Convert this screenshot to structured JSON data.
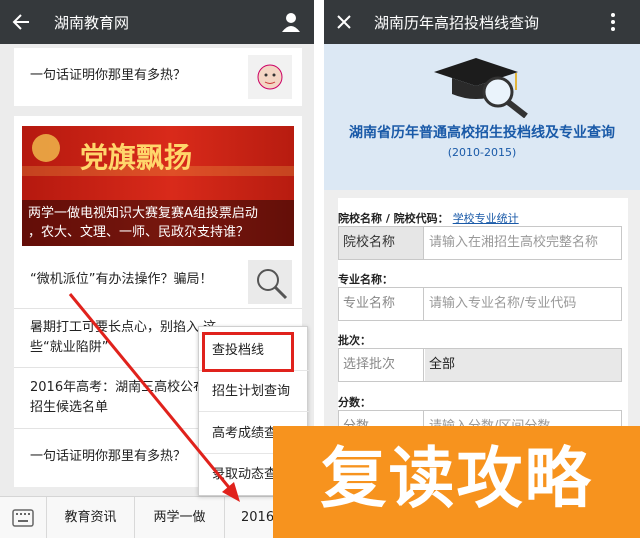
{
  "colors": {
    "topbar": "#35393c",
    "accent_red": "#e0221c",
    "link": "#1a5aa8",
    "overlay": "#f7931e"
  },
  "left": {
    "title": "湖南教育网",
    "feed": [
      {
        "text": "一句话证明你那里有多热？",
        "thumb": "cartoon-thumb"
      },
      {
        "banner_text_line1": "党旗飘扬",
        "caption_line1": "两学一做电视知识大赛复赛A组投票启动",
        "caption_line2": "，农大、文理、一师、民政尕支持谁？"
      },
      {
        "text": "“微机派位”有办法操作？骗局！",
        "thumb": "magnifier-thumb"
      },
      {
        "text_line1": "暑期打工可要长点心，别掐入 这",
        "text_line2": "些“就业陷阱”"
      },
      {
        "text_line1": "2016年高考：湖南三高校公布",
        "text_line2": "招生候选名单"
      },
      {
        "text": "一句话证明你那里有多热？"
      }
    ],
    "popup": [
      "查投档线",
      "招生计划查询",
      "高考成绩查",
      "录取动态查"
    ],
    "bottom_nav": {
      "item1": "教育资讯",
      "item2": "两学一做",
      "item3": "2016高考"
    }
  },
  "right": {
    "title": "湖南历年高招投档线查询",
    "hero_title": "湖南省历年普通高校招生投档线及专业查询",
    "hero_years": "(2010-2015)",
    "school_label": "院校名称 / 院校代码：",
    "school_link": "学校专业统计",
    "school_field_label": "院校名称",
    "school_placeholder": "请输入在湘招生高校完整名称",
    "major_label": "专业名称：",
    "major_field_label": "专业名称",
    "major_placeholder": "请输入专业名称/专业代码",
    "batch_label": "批次：",
    "batch_field_label": "选择批次",
    "batch_value": "全部",
    "score_label": "分数：",
    "score_field_label": "分数",
    "score_placeholder": "请输入分数/区间分数"
  },
  "overlay_text": "复读攻略"
}
